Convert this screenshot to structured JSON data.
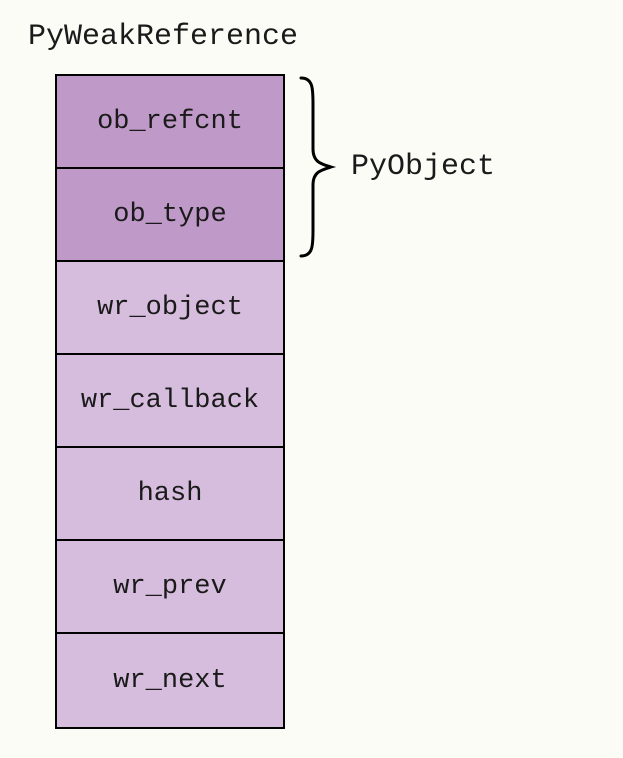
{
  "title": "PyWeakReference",
  "annotation_label": "PyObject",
  "fields": {
    "f0": "ob_refcnt",
    "f1": "ob_type",
    "f2": "wr_object",
    "f3": "wr_callback",
    "f4": "hash",
    "f5": "wr_prev",
    "f6": "wr_next"
  }
}
